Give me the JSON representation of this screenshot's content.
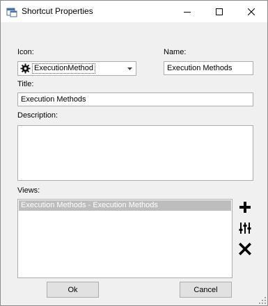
{
  "window": {
    "title": "Shortcut Properties",
    "title_icon": "window-app-icon"
  },
  "form": {
    "icon_label": "Icon:",
    "icon_value": "ExecutionMethod",
    "icon_glyph": "gear-icon",
    "name_label": "Name:",
    "name_value": "Execution Methods",
    "title_label": "Title:",
    "title_value": "Execution Methods",
    "description_label": "Description:",
    "description_value": "",
    "views_label": "Views:",
    "views": [
      "Execution Methods - Execution Methods"
    ]
  },
  "side_buttons": {
    "add": "plus-icon",
    "edit": "sliders-icon",
    "remove": "x-icon"
  },
  "buttons": {
    "ok": "Ok",
    "cancel": "Cancel"
  },
  "colors": {
    "selection": "#bdbdbd",
    "background": "#f0f0f0"
  }
}
